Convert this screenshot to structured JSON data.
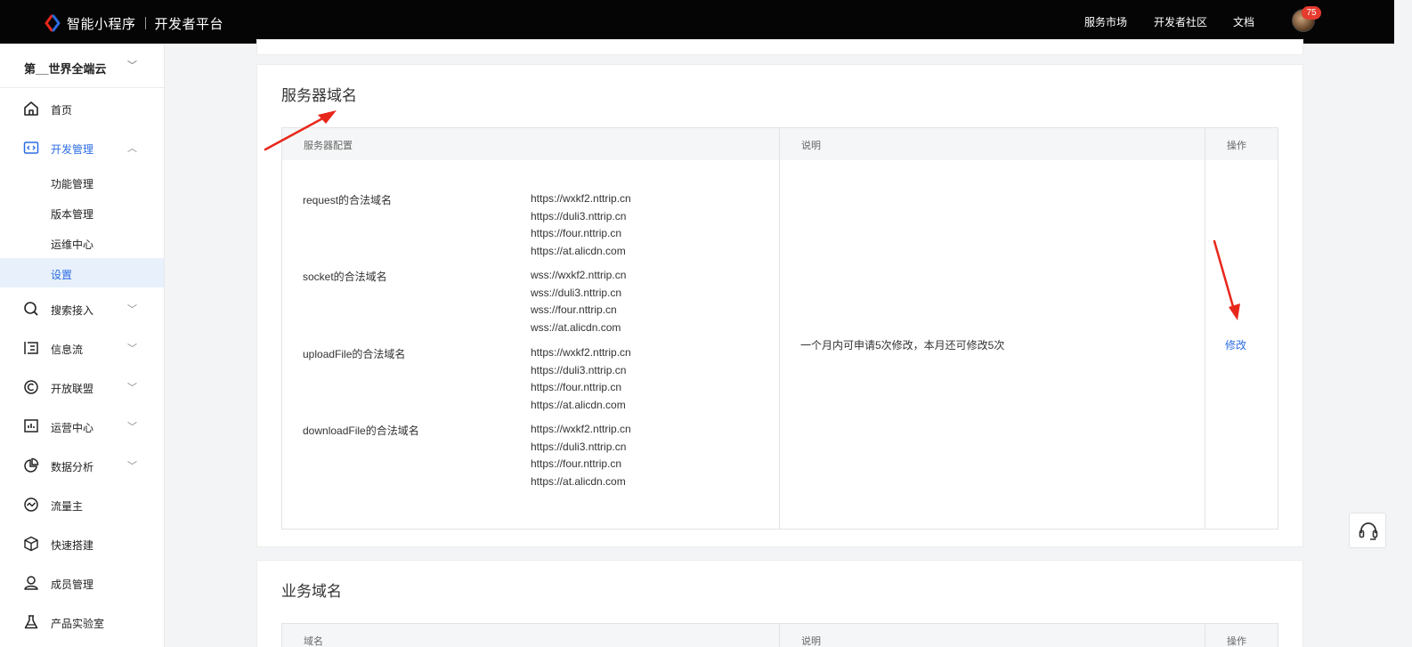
{
  "topbar": {
    "brand": "智能小程序",
    "platform": "开发者平台",
    "nav": [
      "服务市场",
      "开发者社区",
      "文档"
    ],
    "notification_count": "75"
  },
  "sidebar": {
    "org_name": "第__世界全端云",
    "home": "首页",
    "dev_manage": "开发管理",
    "sub_items": [
      "功能管理",
      "版本管理",
      "运维中心",
      "设置"
    ],
    "items": [
      {
        "label": "搜索接入",
        "icon": "search-icon"
      },
      {
        "label": "信息流",
        "icon": "feed-icon"
      },
      {
        "label": "开放联盟",
        "icon": "copyright-icon"
      },
      {
        "label": "运营中心",
        "icon": "chart-icon"
      },
      {
        "label": "数据分析",
        "icon": "pie-icon"
      },
      {
        "label": "流量主",
        "icon": "traffic-icon"
      },
      {
        "label": "快速搭建",
        "icon": "cube-icon"
      },
      {
        "label": "成员管理",
        "icon": "user-icon"
      },
      {
        "label": "产品实验室",
        "icon": "flask-icon"
      }
    ]
  },
  "server_domains": {
    "title": "服务器域名",
    "headers": [
      "服务器配置",
      "说明",
      "操作"
    ],
    "rows": [
      {
        "label": "request的合法域名",
        "urls": [
          "https://wxkf2.nttrip.cn",
          "https://duli3.nttrip.cn",
          "https://four.nttrip.cn",
          "https://at.alicdn.com"
        ]
      },
      {
        "label": "socket的合法域名",
        "urls": [
          "wss://wxkf2.nttrip.cn",
          "wss://duli3.nttrip.cn",
          "wss://four.nttrip.cn",
          "wss://at.alicdn.com"
        ]
      },
      {
        "label": "uploadFile的合法域名",
        "urls": [
          "https://wxkf2.nttrip.cn",
          "https://duli3.nttrip.cn",
          "https://four.nttrip.cn",
          "https://at.alicdn.com"
        ]
      },
      {
        "label": "downloadFile的合法域名",
        "urls": [
          "https://wxkf2.nttrip.cn",
          "https://duli3.nttrip.cn",
          "https://four.nttrip.cn",
          "https://at.alicdn.com"
        ]
      }
    ],
    "description": "一个月内可申请5次修改，本月还可修改5次",
    "action": "修改"
  },
  "business_domains": {
    "title": "业务域名",
    "headers": [
      "域名",
      "说明",
      "操作"
    ]
  },
  "colors": {
    "accent": "#2a6ce3",
    "topbar": "#050505",
    "annotation": "#e8271b"
  }
}
